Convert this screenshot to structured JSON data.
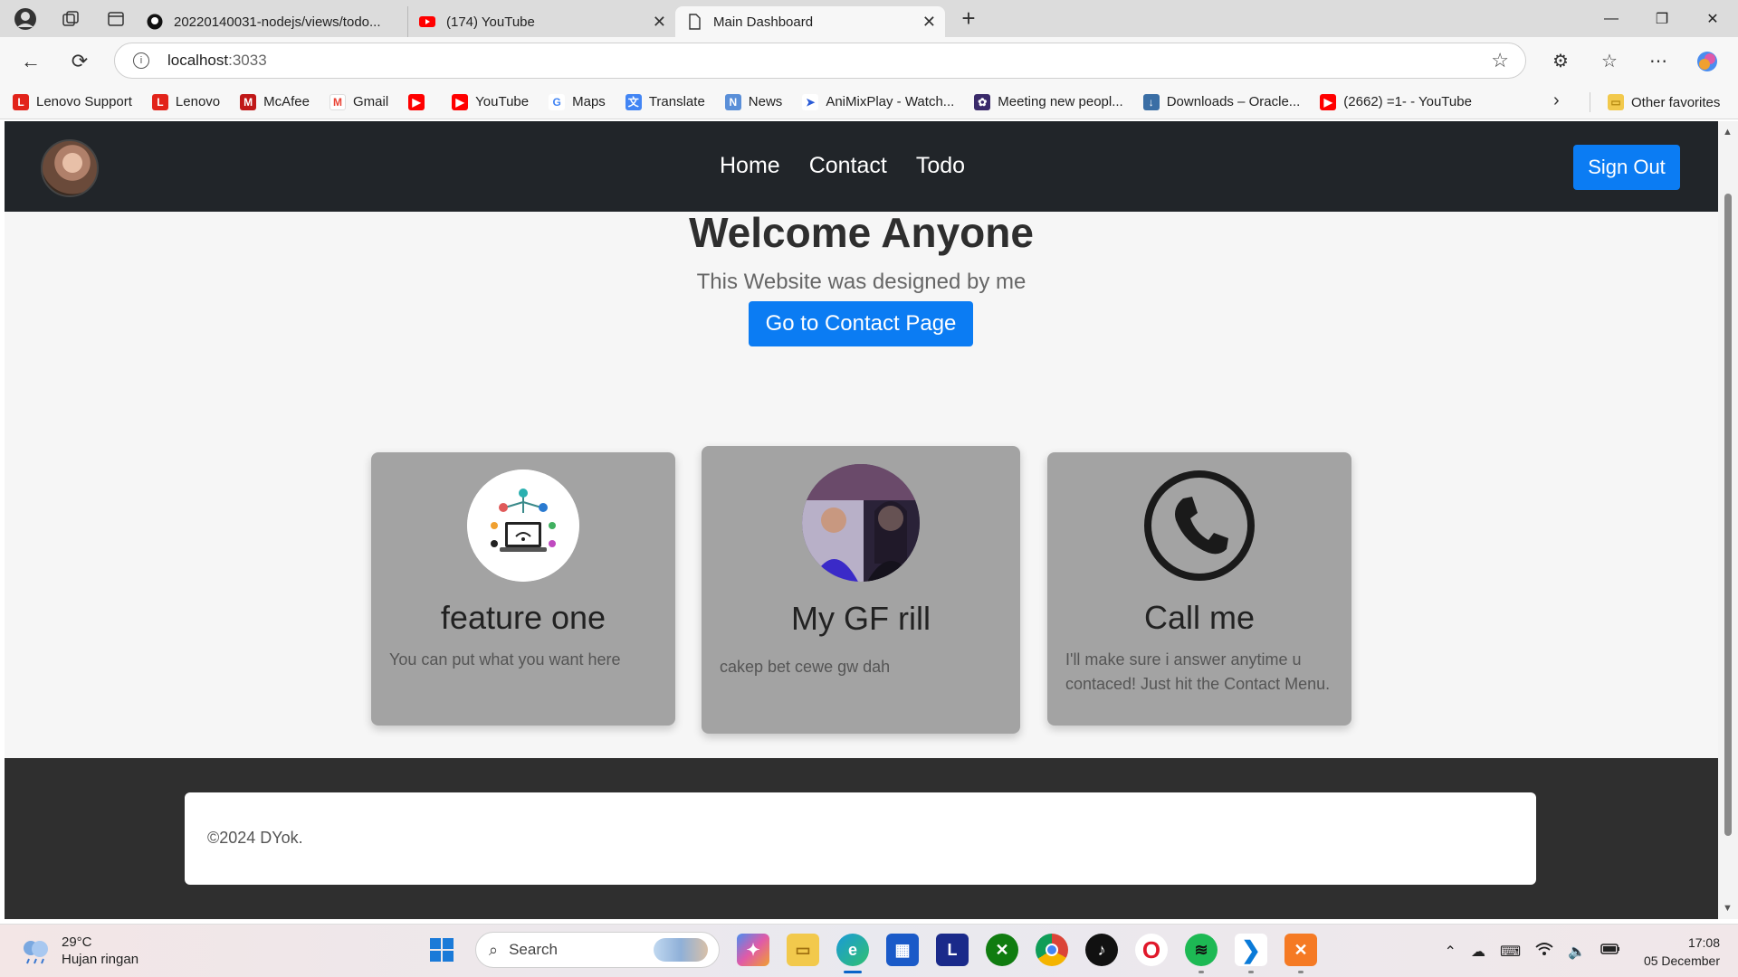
{
  "browser": {
    "tabs": [
      {
        "label": "20220140031-nodejs/views/todo...",
        "icon": "github-icon"
      },
      {
        "label": "(174) YouTube",
        "icon": "youtube-icon"
      },
      {
        "label": "Main Dashboard",
        "icon": "page-icon",
        "active": true
      }
    ],
    "address": {
      "host": "localhost",
      "port": ":3033"
    },
    "bookmarks": [
      {
        "label": "Lenovo Support",
        "icon": "lenovo-icon",
        "color": "#e2231a"
      },
      {
        "label": "Lenovo",
        "icon": "lenovo-icon",
        "color": "#e2231a"
      },
      {
        "label": "McAfee",
        "icon": "mcafee-icon",
        "color": "#c01818"
      },
      {
        "label": "Gmail",
        "icon": "gmail-icon",
        "color": "#ea4335"
      },
      {
        "label": "",
        "icon": "youtube-icon",
        "color": "#ff0000"
      },
      {
        "label": "YouTube",
        "icon": "youtube-icon",
        "color": "#ff0000"
      },
      {
        "label": "Maps",
        "icon": "google-icon",
        "color": "#4285f4"
      },
      {
        "label": "Translate",
        "icon": "translate-icon",
        "color": "#4285f4"
      },
      {
        "label": "News",
        "icon": "news-icon",
        "color": "#5a8fd8"
      },
      {
        "label": "AniMixPlay - Watch...",
        "icon": "animix-icon",
        "color": "#2a5bd7"
      },
      {
        "label": "Meeting new peopl...",
        "icon": "meeting-icon",
        "color": "#3a2a6a"
      },
      {
        "label": "Downloads – Oracle...",
        "icon": "oracle-icon",
        "color": "#3a6ea5"
      },
      {
        "label": "(2662) =1- - YouTube",
        "icon": "youtube-icon",
        "color": "#ff0000"
      }
    ],
    "other_favorites": "Other favorites"
  },
  "site": {
    "nav": {
      "links": [
        "Home",
        "Contact",
        "Todo"
      ],
      "signout": "Sign Out"
    },
    "hero": {
      "title": "Welcome Anyone",
      "subtitle": "This Website was designed by me",
      "button": "Go to Contact Page"
    },
    "cards": [
      {
        "title": "feature one",
        "text": "You can put what you want here"
      },
      {
        "title": "My GF rill",
        "text": "cakep bet cewe gw dah"
      },
      {
        "title": "Call me",
        "text": "I'll make sure i answer anytime u contaced! Just hit the Contact Menu."
      }
    ],
    "footer": "©2024 DYok."
  },
  "taskbar": {
    "weather": {
      "temp": "29°C",
      "desc": "Hujan ringan"
    },
    "search": "Search",
    "clock": {
      "time": "17:08",
      "date": "05 December"
    }
  },
  "colors": {
    "primary": "#0b7cf3",
    "navbar": "#212529",
    "card": "#a3a3a3",
    "footer": "#2f2f2f"
  }
}
